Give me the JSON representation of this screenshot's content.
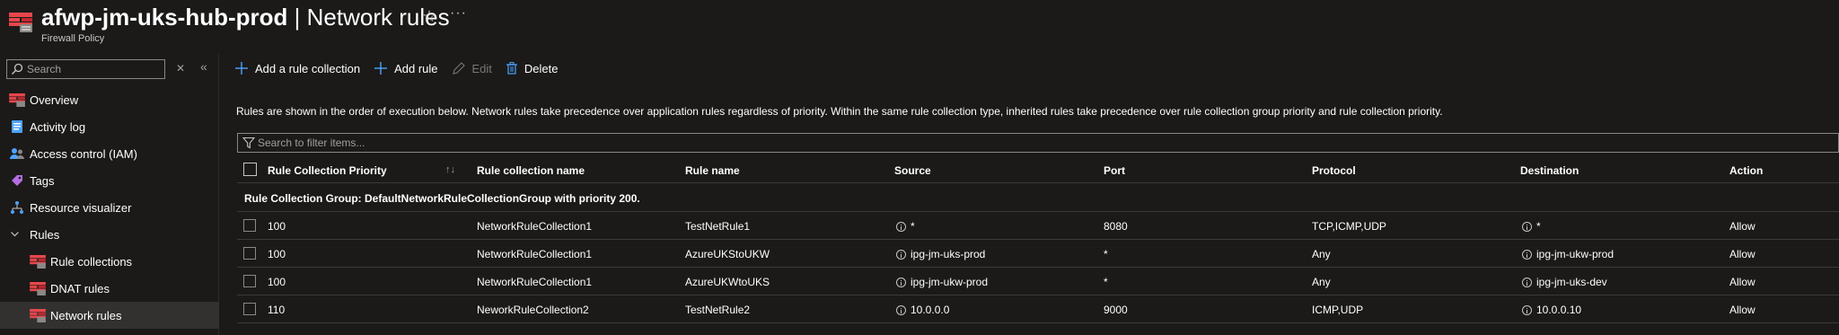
{
  "header": {
    "resource_name": "afwp-jm-uks-hub-prod",
    "separator": "|",
    "page_name": "Network rules",
    "subtitle": "Firewall Policy",
    "star_icon": "star-icon",
    "more_icon": "ellipsis-icon"
  },
  "sidebar": {
    "search_placeholder": "Search",
    "items": [
      {
        "label": "Overview",
        "icon": "firewall-policy-icon"
      },
      {
        "label": "Activity log",
        "icon": "activity-log-icon"
      },
      {
        "label": "Access control (IAM)",
        "icon": "people-icon"
      },
      {
        "label": "Tags",
        "icon": "tag-icon"
      },
      {
        "label": "Resource visualizer",
        "icon": "resource-visualizer-icon"
      },
      {
        "label": "Rules",
        "icon": "chevron-down-icon"
      },
      {
        "label": "Rule collections",
        "icon": "firewall-policy-icon"
      },
      {
        "label": "DNAT rules",
        "icon": "firewall-policy-icon"
      },
      {
        "label": "Network rules",
        "icon": "firewall-policy-icon"
      }
    ]
  },
  "toolbar": {
    "add_collection": "Add a rule collection",
    "add_rule": "Add rule",
    "edit": "Edit",
    "delete": "Delete"
  },
  "info_text": "Rules are shown in the order of execution below. Network rules take precedence over application rules regardless of priority. Within the same rule collection type, inherited rules take precedence over rule collection group priority and rule collection priority.",
  "filter_placeholder": "Search to filter items...",
  "table": {
    "columns": [
      "Rule Collection Priority",
      "Rule collection name",
      "Rule name",
      "Source",
      "Port",
      "Protocol",
      "Destination",
      "Action"
    ],
    "group_label": "Rule Collection Group: DefaultNetworkRuleCollectionGroup with priority 200.",
    "rows": [
      {
        "priority": "100",
        "collection": "NetworkRuleCollection1",
        "rule": "TestNetRule1",
        "source": "*",
        "port": "8080",
        "protocol": "TCP,ICMP,UDP",
        "destination": "*",
        "action": "Allow"
      },
      {
        "priority": "100",
        "collection": "NetworkRuleCollection1",
        "rule": "AzureUKStoUKW",
        "source": "ipg-jm-uks-prod",
        "port": "*",
        "protocol": "Any",
        "destination": "ipg-jm-ukw-prod",
        "action": "Allow"
      },
      {
        "priority": "100",
        "collection": "NetworkRuleCollection1",
        "rule": "AzureUKWtoUKS",
        "source": "ipg-jm-ukw-prod",
        "port": "*",
        "protocol": "Any",
        "destination": "ipg-jm-uks-dev",
        "action": "Allow"
      },
      {
        "priority": "110",
        "collection": "NeworkRuleCollection2",
        "rule": "TestNetRule2",
        "source": "10.0.0.0",
        "port": "9000",
        "protocol": "ICMP,UDP",
        "destination": "10.0.0.10",
        "action": "Allow"
      }
    ]
  },
  "colors": {
    "background": "#1b1a19",
    "accent_blue": "#4da3ff",
    "firewall_red": "#e8474b",
    "selected_bg": "#323130"
  }
}
